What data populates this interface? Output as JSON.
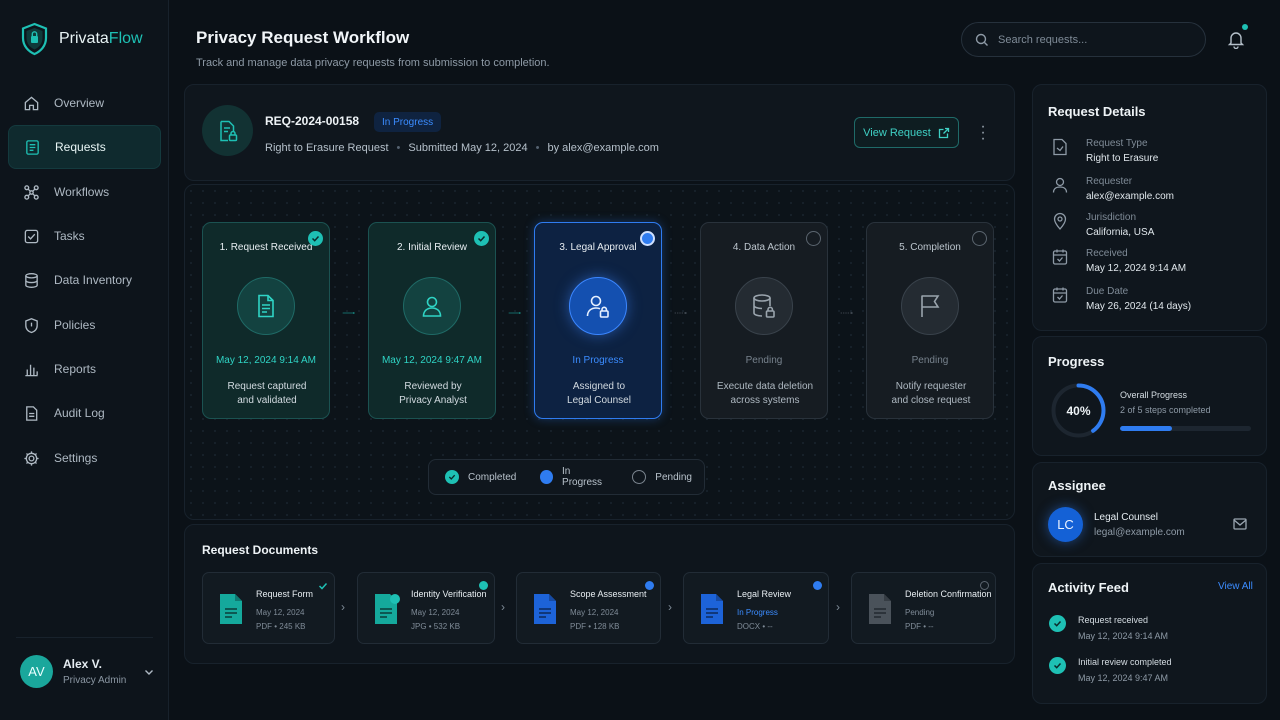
{
  "app": {
    "name_prefix": "Privata",
    "name_suffix": "Flow"
  },
  "sidebar": {
    "items": [
      {
        "label": "Overview",
        "icon": "home-icon"
      },
      {
        "label": "Requests",
        "icon": "document-icon",
        "active": true
      },
      {
        "label": "Workflows",
        "icon": "workflow-icon"
      },
      {
        "label": "Tasks",
        "icon": "checkbox-icon"
      },
      {
        "label": "Data Inventory",
        "icon": "database-icon"
      },
      {
        "label": "Policies",
        "icon": "shield-icon"
      },
      {
        "label": "Reports",
        "icon": "bar-chart-icon"
      },
      {
        "label": "Audit Log",
        "icon": "log-icon"
      },
      {
        "label": "Settings",
        "icon": "gear-icon"
      }
    ],
    "user": {
      "initials": "AV",
      "name": "Alex V.",
      "role": "Privacy Admin"
    }
  },
  "header": {
    "title": "Privacy Request Workflow",
    "subtitle": "Track and manage data privacy requests from submission to completion.",
    "search_placeholder": "Search requests..."
  },
  "request": {
    "id": "REQ-2024-00158",
    "status": "In Progress",
    "type": "Right to Erasure Request",
    "submitted": "Submitted May 12, 2024",
    "by": "by alex@example.com",
    "view_label": "View Request"
  },
  "steps": [
    {
      "title": "1. Request Received",
      "status": "May 12, 2024   9:14 AM",
      "desc1": "Request captured",
      "desc2": "and validated",
      "state": "done"
    },
    {
      "title": "2. Initial Review",
      "status": "May 12, 2024   9:47 AM",
      "desc1": "Reviewed by",
      "desc2": "Privacy Analyst",
      "state": "done"
    },
    {
      "title": "3. Legal Approval",
      "status": "In Progress",
      "desc1": "Assigned to",
      "desc2": "Legal Counsel",
      "state": "prog"
    },
    {
      "title": "4. Data Action",
      "status": "Pending",
      "desc1": "Execute data deletion",
      "desc2": "across systems",
      "state": "pend"
    },
    {
      "title": "5. Completion",
      "status": "Pending",
      "desc1": "Notify requester",
      "desc2": "and close request",
      "state": "pend"
    }
  ],
  "legend": {
    "completed": "Completed",
    "in_progress": "In Progress",
    "pending": "Pending"
  },
  "documents": {
    "title": "Request Documents",
    "items": [
      {
        "name": "Request Form",
        "date": "May 12, 2024",
        "meta": "PDF  •  245 KB"
      },
      {
        "name": "Identity Verification",
        "date": "May 12, 2024",
        "meta": "JPG  •  532 KB"
      },
      {
        "name": "Scope Assessment",
        "date": "May 12, 2024",
        "meta": "PDF  •  128 KB"
      },
      {
        "name": "Legal Review",
        "date": "In Progress",
        "meta": "DOCX  •  --"
      },
      {
        "name": "Deletion Confirmation",
        "date": "Pending",
        "meta": "PDF  •  --"
      }
    ]
  },
  "details": {
    "title": "Request Details",
    "rows": [
      {
        "label": "Request Type",
        "value": "Right to Erasure"
      },
      {
        "label": "Requester",
        "value": "alex@example.com"
      },
      {
        "label": "Jurisdiction",
        "value": "California, USA"
      },
      {
        "label": "Received",
        "value": "May 12, 2024   9:14 AM"
      },
      {
        "label": "Due Date",
        "value": "May 26, 2024   (14 days)"
      }
    ]
  },
  "progress": {
    "title": "Progress",
    "percent_label": "40%",
    "percent": 40,
    "label": "Overall Progress",
    "sub": "2 of 5 steps completed"
  },
  "assignee": {
    "title": "Assignee",
    "initials": "LC",
    "name": "Legal Counsel",
    "email": "legal@example.com"
  },
  "activity": {
    "title": "Activity Feed",
    "view_all": "View All",
    "items": [
      {
        "title": "Request received",
        "time": "May 12, 2024   9:14 AM"
      },
      {
        "title": "Initial review completed",
        "time": "May 12, 2024   9:47 AM"
      }
    ]
  },
  "colors": {
    "accent": "#1ec0b4",
    "progress_blue": "#2f7cf0",
    "pending_gray": "#5b656f",
    "background": "#0b1117"
  }
}
